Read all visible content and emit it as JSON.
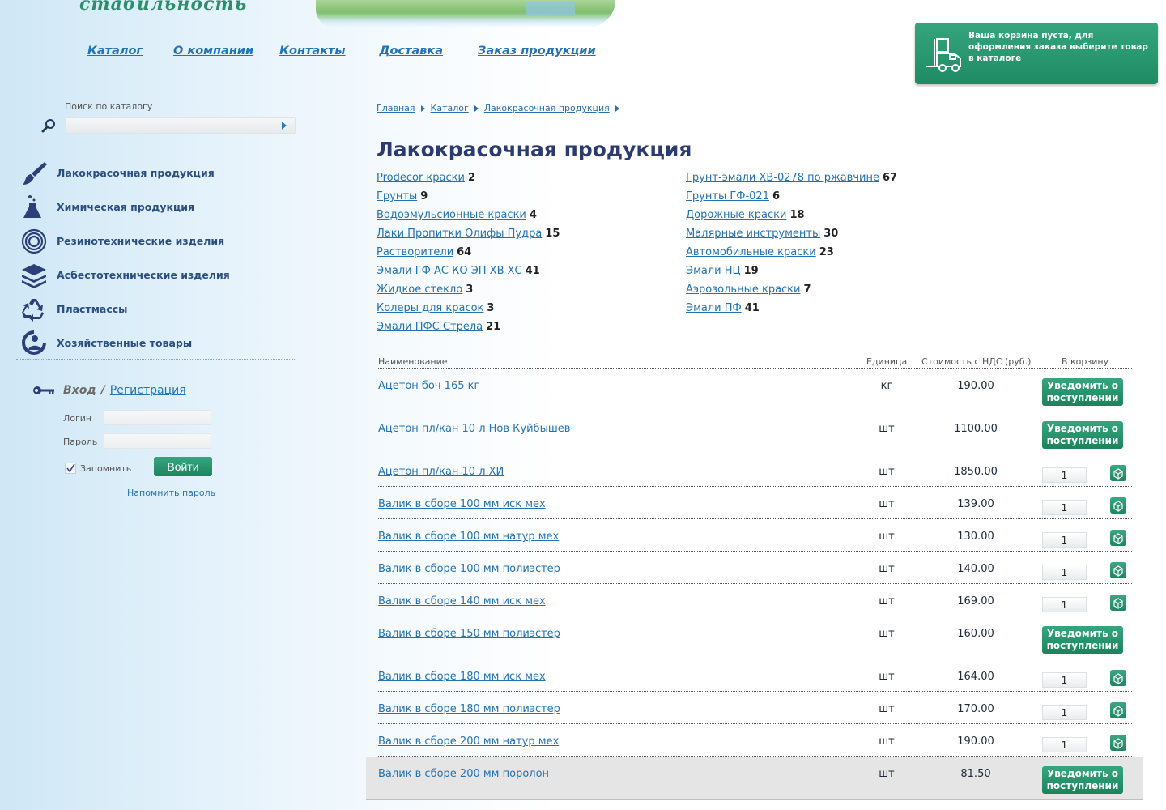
{
  "header": {
    "logo_text": "стабильность",
    "nav": [
      "Каталог",
      "О компании",
      "Контакты",
      "Доставка",
      "Заказ продукции"
    ]
  },
  "cart": {
    "message": "Ваша корзина пуста, для оформления заказа выберите товар в каталоге"
  },
  "search": {
    "label": "Поиск по каталогу",
    "placeholder": ""
  },
  "sidebar": {
    "items": [
      {
        "label": "Лакокрасочная продукция",
        "icon": "paint-brush-icon"
      },
      {
        "label": "Химическая продукция",
        "icon": "flask-icon"
      },
      {
        "label": "Резинотехнические изделия",
        "icon": "rubber-ring-icon"
      },
      {
        "label": "Асбестотехнические изделия",
        "icon": "layers-icon"
      },
      {
        "label": "Пластмассы",
        "icon": "recycle-icon"
      },
      {
        "label": "Хозяйственные товары",
        "icon": "household-icon"
      }
    ]
  },
  "login": {
    "enter_label": "Вход",
    "separator": "/",
    "register_label": "Регистрация",
    "login_label": "Логин",
    "password_label": "Пароль",
    "remember_label": "Запомнить",
    "submit_label": "Войти",
    "forgot_label": "Напомнить пароль"
  },
  "breadcrumb": [
    "Главная",
    "Каталог",
    "Лакокрасочная продукция"
  ],
  "page_title": "Лакокрасочная продукция",
  "subcategories_left": [
    {
      "name": "Prodecor краски",
      "count": "2"
    },
    {
      "name": "Грунты",
      "count": "9"
    },
    {
      "name": "Водоэмульсионные краски",
      "count": "4"
    },
    {
      "name": "Лаки Пропитки Олифы Пудра",
      "count": "15"
    },
    {
      "name": "Растворители",
      "count": "64"
    },
    {
      "name": "Эмали ГФ АС КО ЭП ХВ ХС",
      "count": "41"
    },
    {
      "name": "Жидкое стекло",
      "count": "3"
    },
    {
      "name": "Колеры для красок",
      "count": "3"
    },
    {
      "name": "Эмали ПФС Стрела",
      "count": "21"
    }
  ],
  "subcategories_right": [
    {
      "name": "Грунт-эмали ХВ-0278 по ржавчине",
      "count": "67"
    },
    {
      "name": "Грунты ГФ-021",
      "count": "6"
    },
    {
      "name": "Дорожные краски",
      "count": "18"
    },
    {
      "name": "Малярные инструменты",
      "count": "30"
    },
    {
      "name": "Автомобильные краски",
      "count": "23"
    },
    {
      "name": "Эмали НЦ",
      "count": "19"
    },
    {
      "name": "Аэрозольные краски",
      "count": "7"
    },
    {
      "name": "Эмали ПФ",
      "count": "41"
    }
  ],
  "table": {
    "headers": {
      "name": "Наименование",
      "unit": "Единица",
      "price": "Стоимость с НДС (руб.)",
      "cart": "В корзину"
    },
    "notify_label": "Уведомить о поступлении",
    "rows": [
      {
        "name": "Ацетон боч 165 кг",
        "unit": "кг",
        "price": "190.00",
        "action": "notify",
        "qty": ""
      },
      {
        "name": "Ацетон пл/кан 10 л Нов Куйбышев",
        "unit": "шт",
        "price": "1100.00",
        "action": "notify",
        "qty": ""
      },
      {
        "name": "Ацетон пл/кан 10 л ХИ",
        "unit": "шт",
        "price": "1850.00",
        "action": "buy",
        "qty": "1"
      },
      {
        "name": "Валик в сборе 100 мм иск мех",
        "unit": "шт",
        "price": "139.00",
        "action": "buy",
        "qty": "1"
      },
      {
        "name": "Валик в сборе 100 мм натур мех",
        "unit": "шт",
        "price": "130.00",
        "action": "buy",
        "qty": "1"
      },
      {
        "name": "Валик в сборе 100 мм полиэстер",
        "unit": "шт",
        "price": "140.00",
        "action": "buy",
        "qty": "1"
      },
      {
        "name": "Валик в сборе 140 мм иск мех",
        "unit": "шт",
        "price": "169.00",
        "action": "buy",
        "qty": "1"
      },
      {
        "name": "Валик в сборе 150 мм полиэстер",
        "unit": "шт",
        "price": "160.00",
        "action": "notify",
        "qty": ""
      },
      {
        "name": "Валик в сборе 180 мм иск мех",
        "unit": "шт",
        "price": "164.00",
        "action": "buy",
        "qty": "1"
      },
      {
        "name": "Валик в сборе 180 мм полиэстер",
        "unit": "шт",
        "price": "170.00",
        "action": "buy",
        "qty": "1"
      },
      {
        "name": "Валик в сборе 200 мм натур мех",
        "unit": "шт",
        "price": "190.00",
        "action": "buy",
        "qty": "1"
      },
      {
        "name": "Валик в сборе 200 мм поролон",
        "unit": "шт",
        "price": "81.50",
        "action": "notify",
        "qty": "",
        "highlighted": true
      }
    ]
  },
  "colors": {
    "accent_green": "#1f8b63",
    "link_blue": "#2273b6",
    "title_navy": "#2b3a70"
  }
}
